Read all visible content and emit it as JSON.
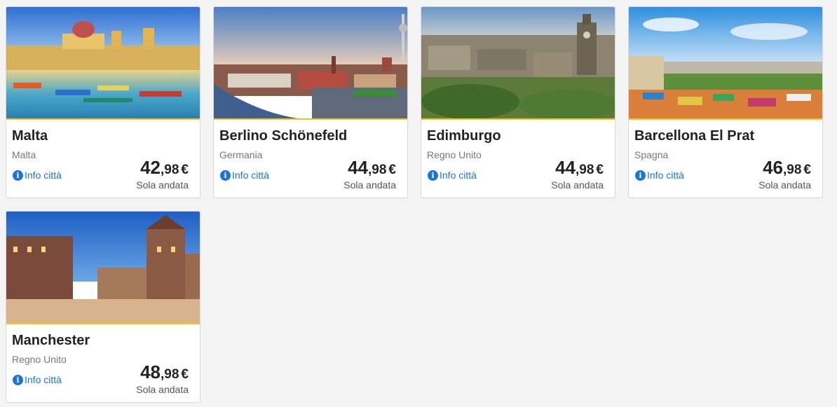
{
  "colors": {
    "accent": "#f5c518",
    "link": "#1a73d9"
  },
  "cards": [
    {
      "city": "Malta",
      "country": "Malta",
      "info": "Info città",
      "price_int": "42",
      "price_dec": ",98",
      "currency": "€",
      "fare": "Sola andata"
    },
    {
      "city": "Berlino Schönefeld",
      "country": "Germania",
      "info": "Info città",
      "price_int": "44",
      "price_dec": ",98",
      "currency": "€",
      "fare": "Sola andata"
    },
    {
      "city": "Edimburgo",
      "country": "Regno Unito",
      "info": "Info città",
      "price_int": "44",
      "price_dec": ",98",
      "currency": "€",
      "fare": "Sola andata"
    },
    {
      "city": "Barcellona El Prat",
      "country": "Spagna",
      "info": "Info città",
      "price_int": "46",
      "price_dec": ",98",
      "currency": "€",
      "fare": "Sola andata"
    },
    {
      "city": "Manchester",
      "country": "Regno Unito",
      "info": "Info città",
      "price_int": "48",
      "price_dec": ",98",
      "currency": "€",
      "fare": "Sola andata"
    }
  ]
}
